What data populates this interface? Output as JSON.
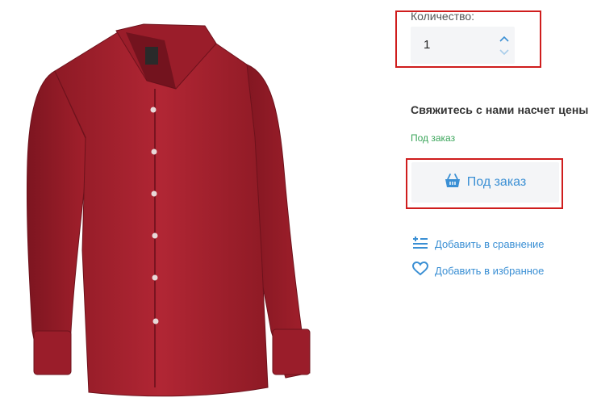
{
  "quantity": {
    "label": "Количество:",
    "value": "1"
  },
  "price_notice": "Свяжитесь с нами насчет цены",
  "availability": "Под заказ",
  "order_button": {
    "label": "Под заказ",
    "icon": "basket-icon"
  },
  "actions": {
    "compare_label": "Добавить в сравнение",
    "favorites_label": "Добавить в избранное"
  },
  "colors": {
    "accent": "#3a8fd4",
    "available": "#3aa55a",
    "highlight": "#cf1d1d",
    "shirt": "#a3202c"
  }
}
